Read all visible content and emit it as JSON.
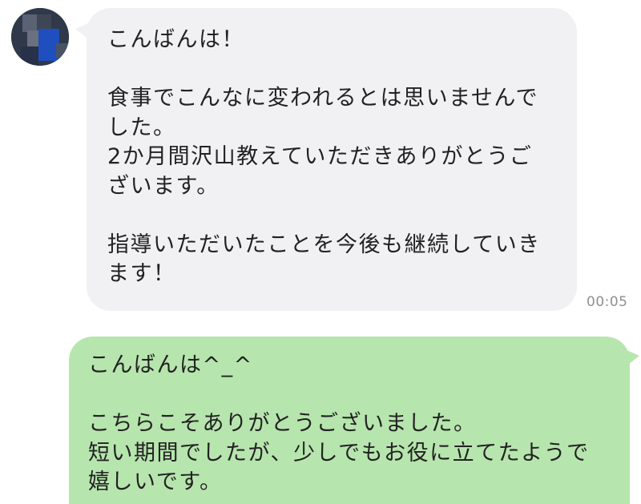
{
  "incoming_message": {
    "lines": [
      "こんばんは！",
      "",
      "食事でこんなに変われるとは思いませんで",
      "した。",
      "2か月間沢山教えていただきありがとうご",
      "ざいます。",
      "",
      "指導いただいたことを今後も継続していき",
      "ます！"
    ],
    "timestamp": "00:05"
  },
  "outgoing_message": {
    "lines": [
      "こんばんは^_^",
      "",
      "こちらこそありがとうございました。",
      "短い期間でしたが、少しでもお役に立てたようで",
      "嬉しいです。"
    ]
  },
  "colors": {
    "incoming_bubble": "#f1f1f4",
    "outgoing_bubble": "#b7e5ae",
    "text": "#222222",
    "timestamp": "#8f8f95"
  }
}
